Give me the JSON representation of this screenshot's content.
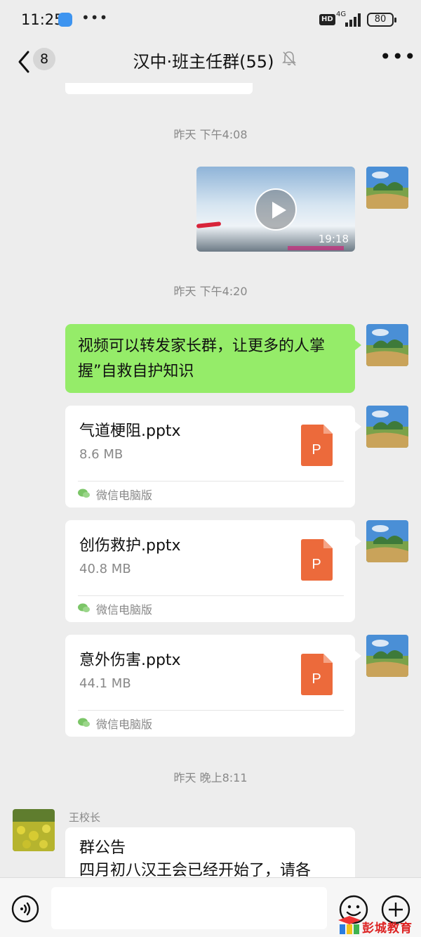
{
  "status_bar": {
    "time": "11:25",
    "dots": "•••",
    "hd": "HD",
    "network": "4G",
    "battery": "80"
  },
  "nav": {
    "badge": "8",
    "title": "汉中·班主任群(55)"
  },
  "messages": {
    "time_1": "昨天 下午4:08",
    "video_duration": "19:18",
    "time_2": "昨天 下午4:20",
    "text_1": "视频可以转发家长群，让更多的人掌握”自救自护知识",
    "files": [
      {
        "name": "气道梗阻.pptx",
        "size": "8.6 MB",
        "source": "微信电脑版",
        "icon_letter": "P"
      },
      {
        "name": "创伤救护.pptx",
        "size": "40.8 MB",
        "source": "微信电脑版",
        "icon_letter": "P"
      },
      {
        "name": "意外伤害.pptx",
        "size": "44.1 MB",
        "source": "微信电脑版",
        "icon_letter": "P"
      }
    ],
    "time_3": "昨天 晚上8:11",
    "sender_name": "王校长",
    "announcement_title": "群公告",
    "announcement_body": "四月初八汉王会已经开始了，请各"
  },
  "watermark": "彭城教育网",
  "colors": {
    "background": "#ededed",
    "self_bubble": "#95ec69",
    "other_bubble": "#ffffff",
    "ppt_icon": "#ec6a3b"
  }
}
